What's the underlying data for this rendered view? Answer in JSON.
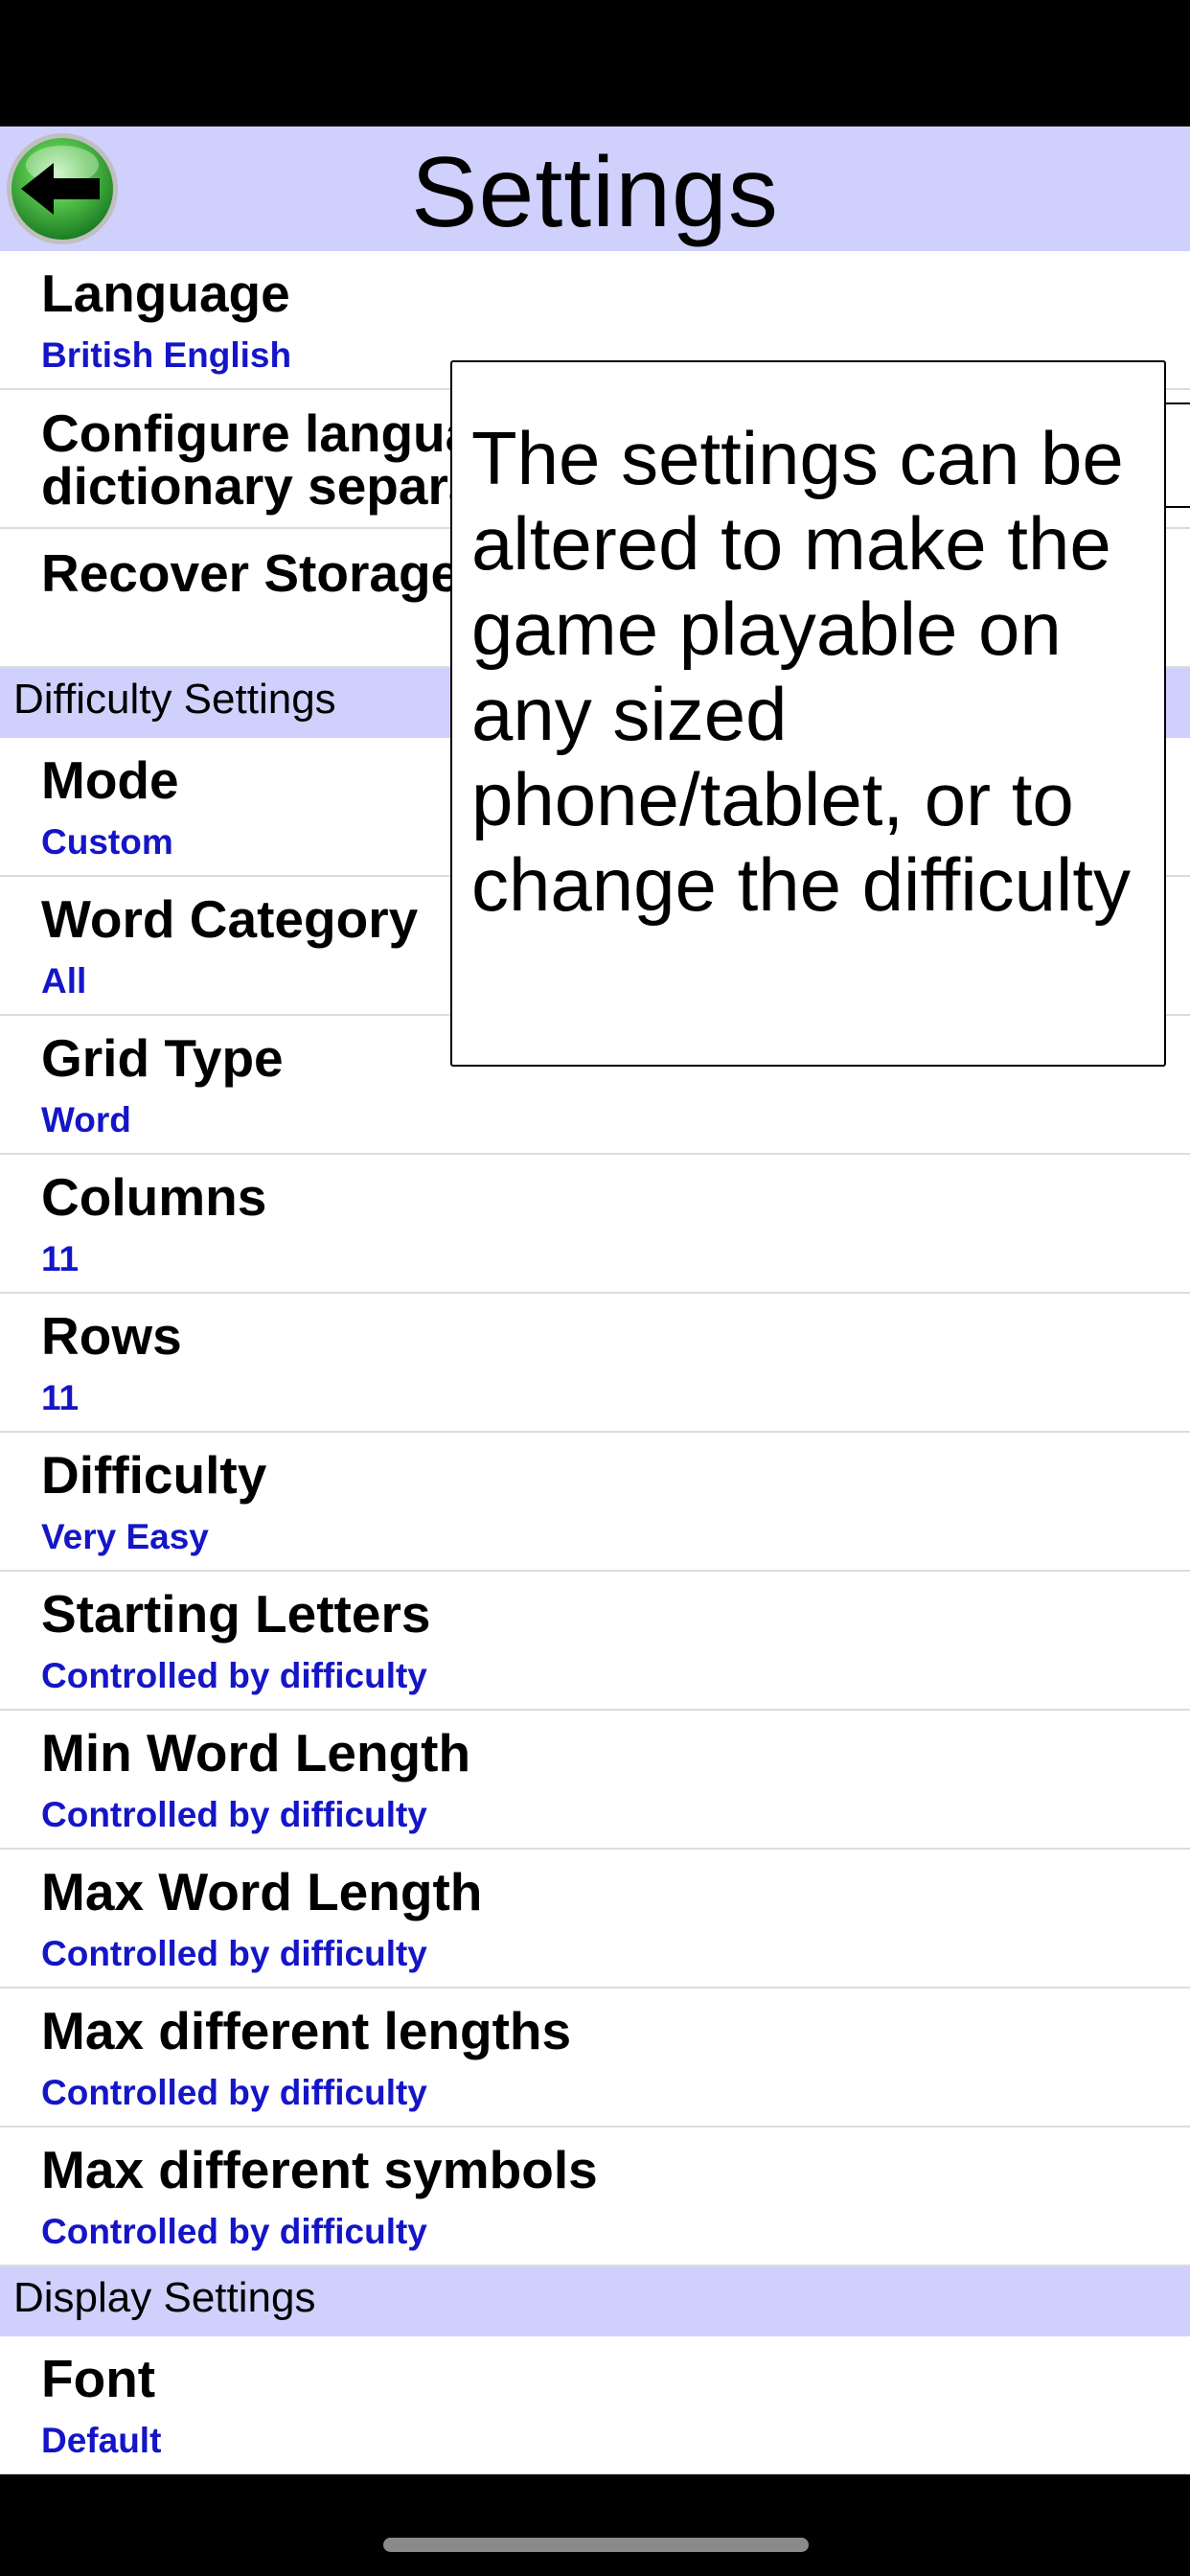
{
  "header": {
    "title": "Settings",
    "back_icon": "back-arrow-icon"
  },
  "general_rows": [
    {
      "title": "Language",
      "value": "British English"
    },
    {
      "title": "Configure language\ndictionary separately",
      "value": ""
    },
    {
      "title": "Recover Storage",
      "value": ""
    }
  ],
  "sections": {
    "difficulty": "Difficulty Settings",
    "display": "Display Settings"
  },
  "difficulty_rows": [
    {
      "title": "Mode",
      "value": "Custom"
    },
    {
      "title": "Word Category",
      "value": "All"
    },
    {
      "title": "Grid Type",
      "value": "Word"
    },
    {
      "title": "Columns",
      "value": "11"
    },
    {
      "title": "Rows",
      "value": "11"
    },
    {
      "title": "Difficulty",
      "value": "Very Easy"
    },
    {
      "title": "Starting Letters",
      "value": "Controlled by difficulty"
    },
    {
      "title": "Min Word Length",
      "value": "Controlled by difficulty"
    },
    {
      "title": "Max Word Length",
      "value": "Controlled by difficulty"
    },
    {
      "title": "Max different lengths",
      "value": "Controlled by difficulty"
    },
    {
      "title": "Max different symbols",
      "value": "Controlled by difficulty"
    }
  ],
  "display_rows": [
    {
      "title": "Font",
      "value": "Default"
    }
  ],
  "tooltip": {
    "text": "The settings can be altered to make the game playable on any sized phone/tablet, or to change the difficulty"
  },
  "colors": {
    "header_bg": "#cfd0fb",
    "value_text": "#1515c8",
    "back_button": "#2ea83a"
  }
}
